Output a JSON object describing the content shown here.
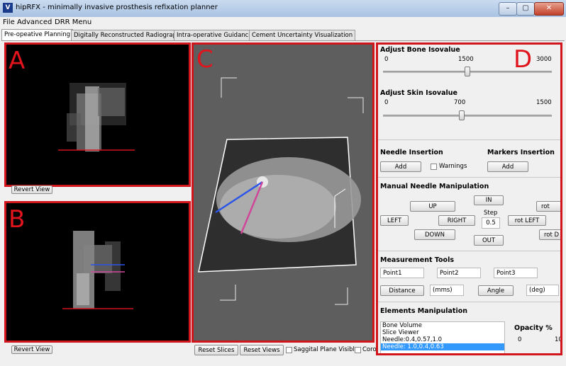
{
  "window": {
    "icon": "V",
    "title": "hipRFX - minimally invasive prosthesis refixation planner",
    "minimize_glyph": "–",
    "maximize_glyph": "▢",
    "close_glyph": "✕"
  },
  "menu": [
    "File",
    "Advanced",
    "DRR Menu"
  ],
  "tabs": [
    "Pre-opeative Planning",
    "Digitally Reconstructed Radiograph",
    "Intra-operative Guidance",
    "Cement Uncertainty Visualization"
  ],
  "panels": {
    "a": "A",
    "b": "B",
    "c": "C",
    "d": "D"
  },
  "left": {
    "revert_view_top": "Revert View",
    "revert_view_bottom": "Revert View"
  },
  "center": {
    "reset_slices": "Reset Slices",
    "reset_views": "Reset Views",
    "saggital_label": "Saggital Plane Visible",
    "coronal_label": "Coro"
  },
  "bone": {
    "title": "Adjust Bone Isovalue",
    "min": "0",
    "mid": "1500",
    "max": "3000",
    "level_fraction": 0.5
  },
  "skin": {
    "title": "Adjust Skin Isovalue",
    "min": "0",
    "mid": "700",
    "max": "1500",
    "level_fraction": 0.467
  },
  "needle_insertion": {
    "title": "Needle Insertion",
    "add": "Add",
    "warnings": "Warnings"
  },
  "markers_insertion": {
    "title": "Markers Insertion",
    "add": "Add"
  },
  "manual": {
    "title": "Manual Needle Manipulation",
    "up": "UP",
    "in": "IN",
    "rot": "rot",
    "left": "LEFT",
    "right": "RIGHT",
    "step_label": "Step",
    "step_value": "0.5",
    "rot_left": "rot LEFT",
    "rot_d": "rot D",
    "down": "DOWN",
    "out": "OUT"
  },
  "measurement": {
    "title": "Measurement Tools",
    "point1": "Point1",
    "point2": "Point2",
    "point3": "Point3",
    "distance": "Distance",
    "mms": "(mms)",
    "angle": "Angle",
    "deg": "(deg)"
  },
  "elements": {
    "title": "Elements Manipulation",
    "items": [
      "Bone Volume",
      "Slice Viewer",
      "Needle:0.4,0.57,1.0",
      "Needle: 1.0,0.4,0.63"
    ],
    "selected_index": 3,
    "opacity_title": "Opacity %",
    "opacity_min": "0",
    "opacity_max": "10"
  },
  "icons": {
    "app": "app-icon",
    "window_controls": [
      "minimize-icon",
      "maximize-icon",
      "close-icon"
    ]
  },
  "colors": {
    "annotation_red": "#d2141c",
    "selection_blue": "#3399ff",
    "needle_blue": "#2b54e8",
    "needle_magenta": "#d0479a"
  }
}
